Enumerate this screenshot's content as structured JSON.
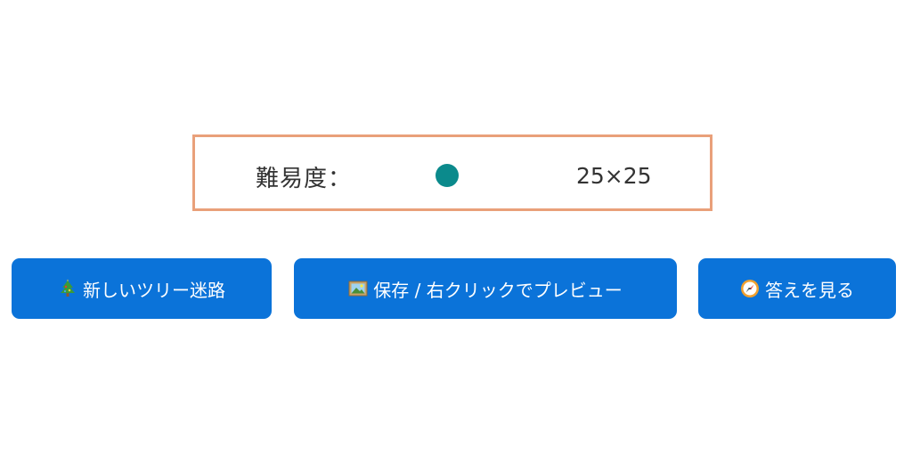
{
  "difficulty": {
    "label": "難易度：",
    "value": "25×25",
    "level": 0.5
  },
  "buttons": {
    "new_maze": {
      "label": "新しいツリー迷路",
      "icon": "christmas-tree-icon"
    },
    "save": {
      "label": "保存 / 右クリックでプレビュー",
      "icon": "framed-picture-icon"
    },
    "answer": {
      "label": "答えを見る",
      "icon": "compass-icon"
    }
  },
  "colors": {
    "box_border": "#e9a07a",
    "slider_thumb": "#0b8a8c",
    "button_bg": "#0b73d9",
    "button_text": "#ffffff",
    "text": "#333333"
  }
}
